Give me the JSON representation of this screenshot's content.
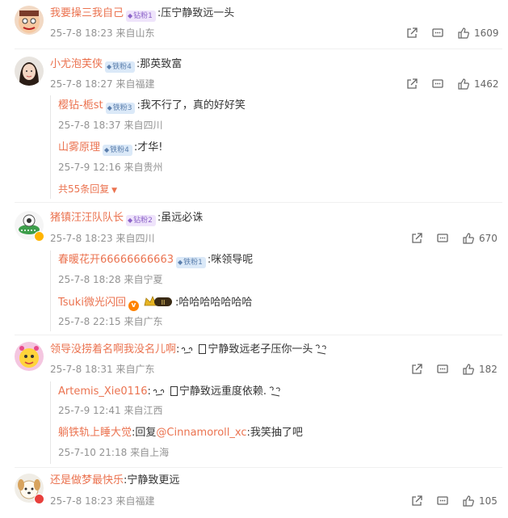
{
  "colors": {
    "accent": "#eb7350",
    "meta": "#939393",
    "iron_badge": "#5b7fad",
    "gold_badge": "#8b62c8"
  },
  "comments": [
    {
      "user": "我要操三我自己",
      "badge": "钻粉1",
      "text": ":压宁静致远一头",
      "time": "25-7-8 18:23",
      "location": "来自山东",
      "likes": "1609",
      "avatar_icon": "cartoon-face-icon"
    },
    {
      "user": "小尤泡芙侠",
      "badge": "铁粉4",
      "text": ":那英致富",
      "time": "25-7-8 18:27",
      "location": "来自福建",
      "likes": "1462",
      "avatar_icon": "girl-photo-icon",
      "replies": [
        {
          "user": "樱钻-栀st",
          "badge": "铁粉3",
          "text": ":我不行了，真的好好笑",
          "time": "25-7-8 18:37",
          "location": "来自四川"
        },
        {
          "user": "山雾原理",
          "badge": "铁粉4",
          "text": ":才华!",
          "time": "25-7-9 12:16",
          "location": "来自贵州"
        }
      ],
      "more": "共55条回复"
    },
    {
      "user": "猪镇汪汪队队长",
      "badge": "钻粉2",
      "text": ":虽远必诛",
      "time": "25-7-8 18:23",
      "location": "来自四川",
      "likes": "670",
      "avatar_icon": "crocodile-icon",
      "replies": [
        {
          "user": "春暖花开66666666663",
          "badge": "铁粉1",
          "text": ":咪领导呢",
          "time": "25-7-8 18:28",
          "location": "来自宁夏"
        },
        {
          "user": "Tsuki微光闪回",
          "crown": "II",
          "text": ":哈哈哈哈哈哈哈",
          "time": "25-7-8 22:15",
          "location": "来自广东"
        }
      ]
    },
    {
      "user": "领导没捞着名啊我没名儿啊",
      "text_pre": ":",
      "text": "宁静致远老子压你一头",
      "time": "25-7-8 18:31",
      "location": "来自广东",
      "likes": "182",
      "avatar_icon": "yellow-character-icon",
      "replies": [
        {
          "user": "Artemis_Xie0116",
          "text_pre": ":",
          "text": "宁静致远重度依赖.",
          "time": "25-7-9 12:41",
          "location": "来自江西"
        },
        {
          "user": "躺铁轨上睡大觉",
          "text_pre": ":回复",
          "mention": "@Cinnamoroll_xc",
          "text": ":我笑抽了吧",
          "time": "25-7-10 21:18",
          "location": "来自上海"
        }
      ]
    },
    {
      "user": "还是做梦最快乐",
      "text": ":宁静致更远",
      "time": "25-7-8 18:23",
      "location": "来自福建",
      "likes": "105",
      "avatar_icon": "puppy-icon"
    }
  ],
  "icons": {
    "share": "share-icon",
    "comment": "comment-icon",
    "like": "thumbs-up-icon"
  }
}
